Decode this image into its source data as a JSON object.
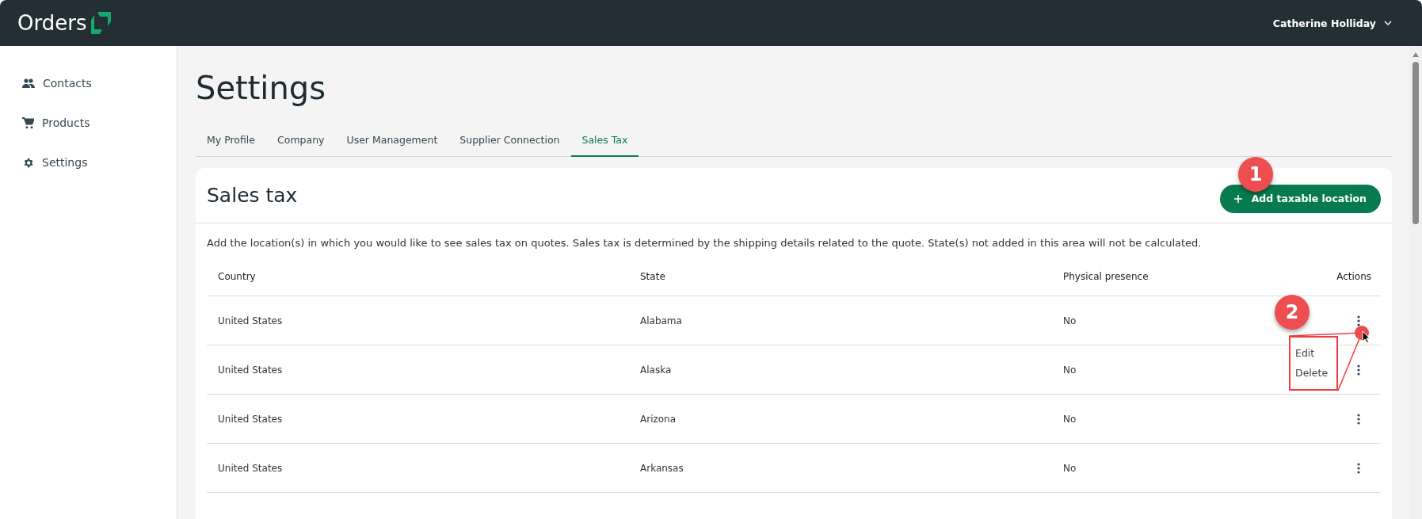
{
  "header": {
    "logo": "Orders",
    "user": "Catherine Holliday"
  },
  "sidebar": {
    "items": [
      {
        "label": "Contacts"
      },
      {
        "label": "Products"
      },
      {
        "label": "Settings"
      }
    ]
  },
  "page": {
    "title": "Settings"
  },
  "tabs": [
    {
      "label": "My Profile",
      "selected": false
    },
    {
      "label": "Company",
      "selected": false
    },
    {
      "label": "User Management",
      "selected": false
    },
    {
      "label": "Supplier Connection",
      "selected": false
    },
    {
      "label": "Sales Tax",
      "selected": true
    }
  ],
  "card": {
    "title": "Sales tax",
    "add_button": "Add taxable location",
    "description": "Add the location(s) in which you would like to see sales tax on quotes. Sales tax is determined by the shipping details related to the quote. State(s) not added in this area will not be calculated."
  },
  "table": {
    "columns": [
      "Country",
      "State",
      "Physical presence",
      "Actions"
    ],
    "rows": [
      {
        "country": "United States",
        "state": "Alabama",
        "physical_presence": "No",
        "menu_open": true
      },
      {
        "country": "United States",
        "state": "Alaska",
        "physical_presence": "No",
        "menu_open": false
      },
      {
        "country": "United States",
        "state": "Arizona",
        "physical_presence": "No",
        "menu_open": false
      },
      {
        "country": "United States",
        "state": "Arkansas",
        "physical_presence": "No",
        "menu_open": false
      }
    ]
  },
  "row_menu": {
    "items": [
      "Edit",
      "Delete"
    ]
  },
  "callouts": [
    "1",
    "2"
  ]
}
